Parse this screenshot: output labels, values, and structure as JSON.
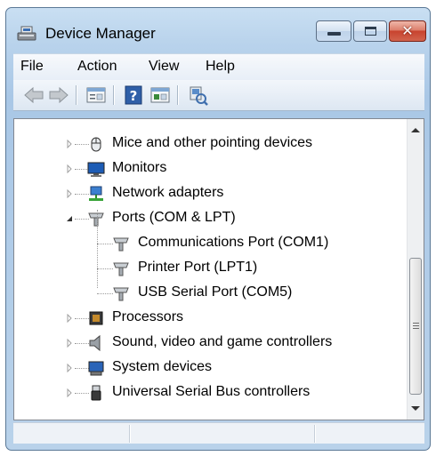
{
  "window": {
    "title": "Device Manager"
  },
  "menubar": {
    "items": [
      "File",
      "Action",
      "View",
      "Help"
    ]
  },
  "toolbar": {
    "buttons": [
      "back-arrow-icon",
      "forward-arrow-icon",
      "properties-icon",
      "help-icon",
      "show-hidden-icon",
      "scan-hardware-icon"
    ]
  },
  "tree": {
    "items": [
      {
        "label": "Mice and other pointing devices",
        "icon": "mouse-icon",
        "expanded": false
      },
      {
        "label": "Monitors",
        "icon": "monitor-icon",
        "expanded": false
      },
      {
        "label": "Network adapters",
        "icon": "network-adapter-icon",
        "expanded": false
      },
      {
        "label": "Ports (COM & LPT)",
        "icon": "port-icon",
        "expanded": true
      },
      {
        "label": "Communications Port (COM1)",
        "icon": "port-icon",
        "child": true
      },
      {
        "label": "Printer Port (LPT1)",
        "icon": "port-icon",
        "child": true
      },
      {
        "label": "USB Serial Port (COM5)",
        "icon": "port-icon",
        "child": true
      },
      {
        "label": "Processors",
        "icon": "processor-icon",
        "expanded": false
      },
      {
        "label": "Sound, video and game controllers",
        "icon": "speaker-icon",
        "expanded": false
      },
      {
        "label": "System devices",
        "icon": "system-device-icon",
        "expanded": false
      },
      {
        "label": "Universal Serial Bus controllers",
        "icon": "usb-icon",
        "expanded": false
      }
    ]
  },
  "colors": {
    "title_bar": "#b9d3ec",
    "close_button": "#c8432e",
    "tree_background": "#ffffff"
  }
}
